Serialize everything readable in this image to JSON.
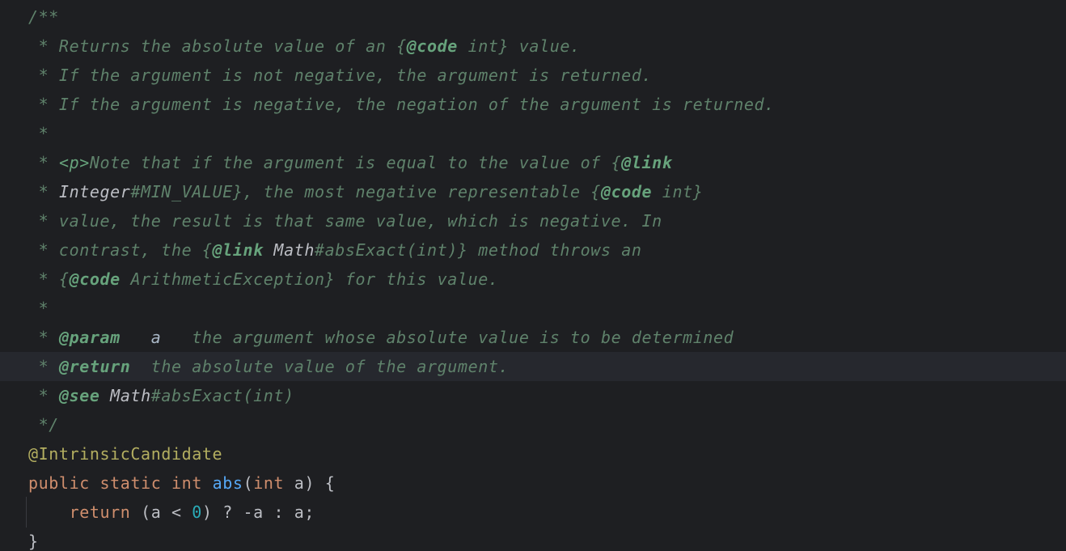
{
  "editor": {
    "lines": [
      [
        {
          "t": "/**",
          "c": "comment"
        }
      ],
      [
        {
          "t": " * Returns the absolute value of an {",
          "c": "comment"
        },
        {
          "t": "@code",
          "c": "tag"
        },
        {
          "t": " int} value.",
          "c": "comment"
        }
      ],
      [
        {
          "t": " * If the argument is not negative, the argument is returned.",
          "c": "comment"
        }
      ],
      [
        {
          "t": " * If the argument is negative, the negation of the argument is returned.",
          "c": "comment"
        }
      ],
      [
        {
          "t": " *",
          "c": "comment"
        }
      ],
      [
        {
          "t": " * ",
          "c": "comment"
        },
        {
          "t": "<p>",
          "c": "html"
        },
        {
          "t": "Note that if the argument is equal to the value of {",
          "c": "comment"
        },
        {
          "t": "@link",
          "c": "tag"
        }
      ],
      [
        {
          "t": " * ",
          "c": "comment"
        },
        {
          "t": "Integer",
          "c": "ref"
        },
        {
          "t": "#MIN_VALUE}, the most negative representable {",
          "c": "comment"
        },
        {
          "t": "@code",
          "c": "tag"
        },
        {
          "t": " int}",
          "c": "comment"
        }
      ],
      [
        {
          "t": " * value, the result is that same value, which is negative. In",
          "c": "comment"
        }
      ],
      [
        {
          "t": " * contrast, the {",
          "c": "comment"
        },
        {
          "t": "@link",
          "c": "tag"
        },
        {
          "t": " ",
          "c": "comment"
        },
        {
          "t": "Math",
          "c": "ref"
        },
        {
          "t": "#absExact(int)} method throws an",
          "c": "comment"
        }
      ],
      [
        {
          "t": " * {",
          "c": "comment"
        },
        {
          "t": "@code",
          "c": "tag"
        },
        {
          "t": " ArithmeticException} for this value.",
          "c": "comment"
        }
      ],
      [
        {
          "t": " *",
          "c": "comment"
        }
      ],
      [
        {
          "t": " * ",
          "c": "comment"
        },
        {
          "t": "@param",
          "c": "tag"
        },
        {
          "t": "   ",
          "c": "comment"
        },
        {
          "t": "a",
          "c": "param"
        },
        {
          "t": "   the argument whose absolute value is to be determined",
          "c": "comment"
        }
      ],
      [
        {
          "t": " * ",
          "c": "comment"
        },
        {
          "t": "@return",
          "c": "tag"
        },
        {
          "t": "  the absolute value of the argument.",
          "c": "comment"
        }
      ],
      [
        {
          "t": " * ",
          "c": "comment"
        },
        {
          "t": "@see",
          "c": "tag"
        },
        {
          "t": " ",
          "c": "comment"
        },
        {
          "t": "Math",
          "c": "ref"
        },
        {
          "t": "#absExact(int)",
          "c": "comment"
        }
      ],
      [
        {
          "t": " */",
          "c": "comment"
        }
      ],
      [
        {
          "t": "@IntrinsicCandidate",
          "c": "anno"
        }
      ],
      [
        {
          "t": "public",
          "c": "kw"
        },
        {
          "t": " ",
          "c": "plain"
        },
        {
          "t": "static",
          "c": "kw"
        },
        {
          "t": " ",
          "c": "plain"
        },
        {
          "t": "int",
          "c": "kw"
        },
        {
          "t": " ",
          "c": "plain"
        },
        {
          "t": "abs",
          "c": "fn"
        },
        {
          "t": "(",
          "c": "plain"
        },
        {
          "t": "int",
          "c": "kw"
        },
        {
          "t": " a) {",
          "c": "plain"
        }
      ],
      [
        {
          "t": "    ",
          "c": "plain"
        },
        {
          "t": "return",
          "c": "kw"
        },
        {
          "t": " (a < ",
          "c": "plain"
        },
        {
          "t": "0",
          "c": "num"
        },
        {
          "t": ") ? -a : a;",
          "c": "plain"
        }
      ],
      [
        {
          "t": "}",
          "c": "plain"
        }
      ]
    ],
    "current_line": 12,
    "colors": {
      "background": "#1e1f22",
      "current_line": "#26282e",
      "comment": "#5f826b",
      "doc_tag": "#67a37c",
      "annotation": "#b3ae60",
      "keyword": "#cf8e6d",
      "function": "#56a8f5",
      "number": "#2aacb8",
      "text": "#bcbec4"
    }
  }
}
